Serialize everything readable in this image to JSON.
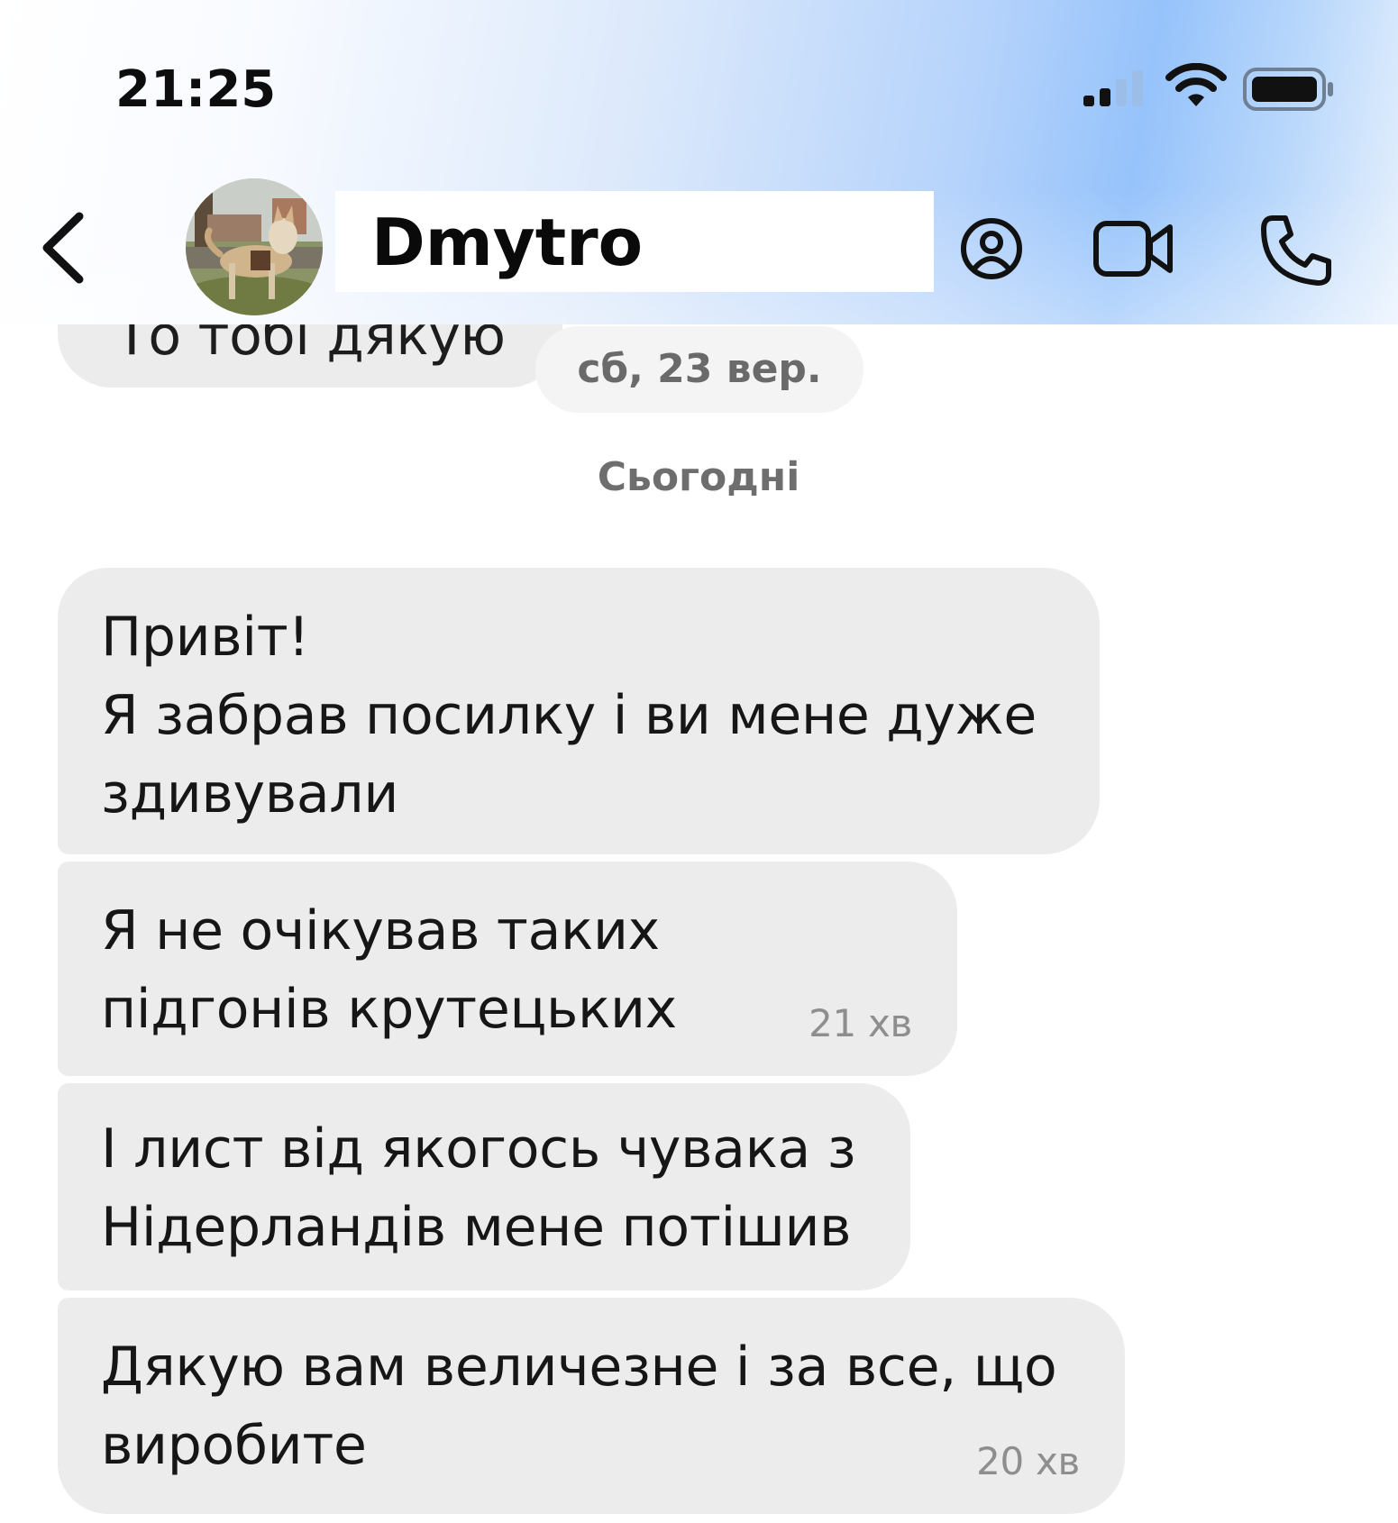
{
  "status_bar": {
    "time": "21:25",
    "icons": [
      "cellular-signal-icon",
      "wifi-icon",
      "battery-icon"
    ]
  },
  "header": {
    "back_icon": "chevron-left-icon",
    "avatar": "contact-avatar",
    "contact_name": "Dmytro",
    "actions": [
      "profile-icon",
      "video-call-icon",
      "phone-call-icon"
    ]
  },
  "chat": {
    "previous_message_partial": "То тобі дякую",
    "date_separator": "сб, 23 вер.",
    "day_label": "Сьогодні",
    "messages": [
      {
        "text": "Привіт!\nЯ забрав посилку і ви мене дуже здивували",
        "time": ""
      },
      {
        "text": "Я не очікував таких підгонів крутецьких",
        "time": "21 хв"
      },
      {
        "text": "І лист від якогось чувака з Нідерландів мене потішив",
        "time": ""
      },
      {
        "text": "Дякую вам величезне і за все, що виробите",
        "time": "20 хв"
      }
    ]
  },
  "colors": {
    "bubble_bg": "#ececec",
    "header_accent": "#96c3fb",
    "text": "#161616",
    "meta": "#8e8e8e"
  }
}
